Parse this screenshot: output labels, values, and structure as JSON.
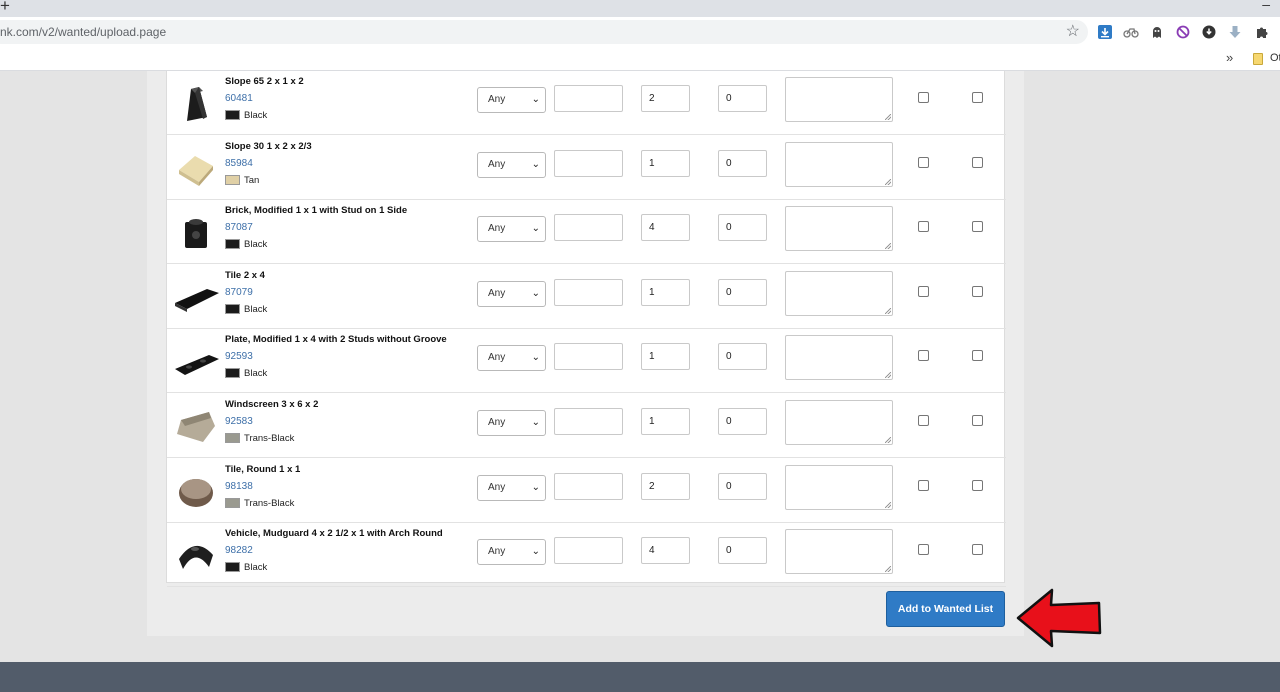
{
  "browser": {
    "url": "nk.com/v2/wanted/upload.page",
    "new_tab": "+",
    "minimize": "–",
    "bookmarks_more": "»",
    "other_bookmarks": "Ot"
  },
  "table": {
    "condition_default": "Any",
    "rows": [
      {
        "name": "Slope 65 2 x 1 x 2",
        "id": "60481",
        "color": "Black",
        "swatch": "#1b1b1b",
        "qty": "2",
        "notify": "0",
        "shape": "slope65"
      },
      {
        "name": "Slope 30 1 x 2 x 2/3",
        "id": "85984",
        "color": "Tan",
        "swatch": "#e0d0a6",
        "qty": "1",
        "notify": "0",
        "shape": "slope30"
      },
      {
        "name": "Brick, Modified 1 x 1 with Stud on 1 Side",
        "id": "87087",
        "color": "Black",
        "swatch": "#1b1b1b",
        "qty": "4",
        "notify": "0",
        "shape": "brick"
      },
      {
        "name": "Tile 2 x 4",
        "id": "87079",
        "color": "Black",
        "swatch": "#1b1b1b",
        "qty": "1",
        "notify": "0",
        "shape": "tile"
      },
      {
        "name": "Plate, Modified 1 x 4 with 2 Studs without Groove",
        "id": "92593",
        "color": "Black",
        "swatch": "#1b1b1b",
        "qty": "1",
        "notify": "0",
        "shape": "plate"
      },
      {
        "name": "Windscreen 3 x 6 x 2",
        "id": "92583",
        "color": "Trans-Black",
        "swatch": "#9a9a90",
        "qty": "1",
        "notify": "0",
        "shape": "windscreen"
      },
      {
        "name": "Tile, Round 1 x 1",
        "id": "98138",
        "color": "Trans-Black",
        "swatch": "#9a9a90",
        "qty": "2",
        "notify": "0",
        "shape": "round"
      },
      {
        "name": "Vehicle, Mudguard 4 x 2 1/2 x 1 with Arch Round",
        "id": "98282",
        "color": "Black",
        "swatch": "#1b1b1b",
        "qty": "4",
        "notify": "0",
        "shape": "mudguard"
      }
    ]
  },
  "actions": {
    "submit_label": "Add to Wanted List"
  },
  "colors": {
    "accent": "#2f7bc6",
    "callout_arrow": "#e8101a",
    "footer": "#525c6a"
  }
}
